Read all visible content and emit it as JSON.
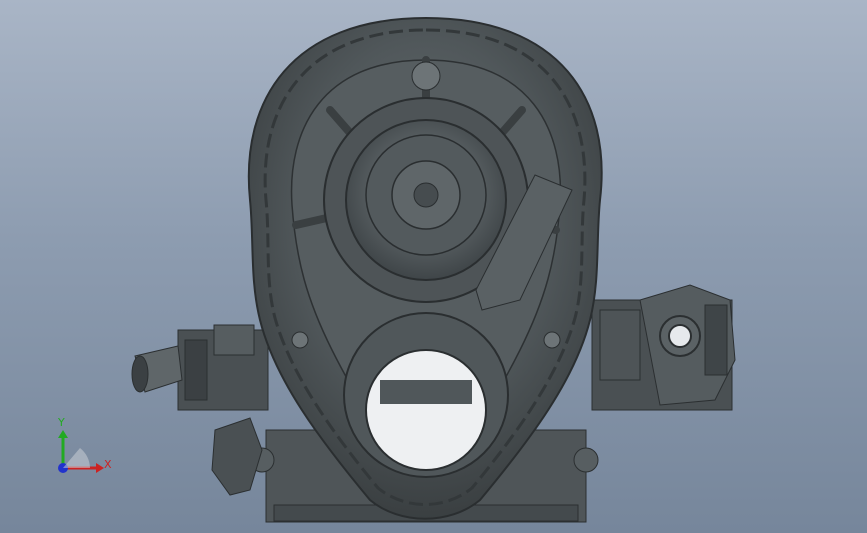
{
  "viewport": {
    "background_top": "#a9b5c6",
    "background_bottom": "#76869b",
    "model_color": "#4b5154",
    "model_dark": "#2e3234",
    "model_light": "#6f7679"
  },
  "triad": {
    "x_label": "X",
    "y_label": "Y",
    "x_color": "#cc2222",
    "y_color": "#22aa22",
    "z_color": "#2233cc"
  }
}
